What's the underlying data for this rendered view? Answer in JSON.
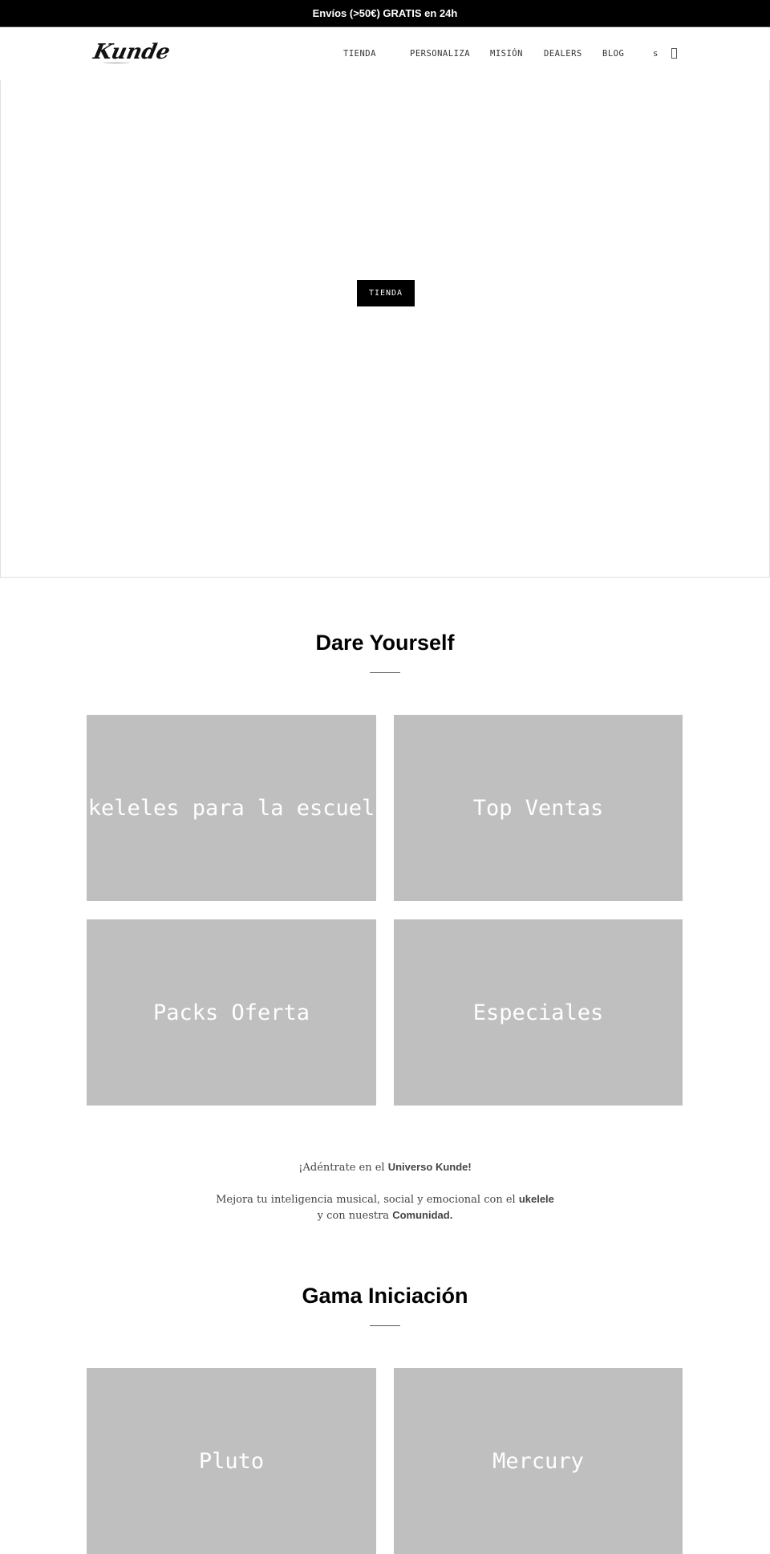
{
  "announcement": {
    "text": "Envíos (>50€) GRATIS en 24h"
  },
  "header": {
    "logo": "Kunde",
    "nav": [
      {
        "label": "TIENDA"
      },
      {
        "label": "PERSONALIZA"
      },
      {
        "label": "MISIÓN"
      },
      {
        "label": "DEALERS"
      },
      {
        "label": "BLOG"
      }
    ],
    "search_label": "s",
    "cart_icon": "cart-icon"
  },
  "hero": {
    "button_label": "TIENDA"
  },
  "dare_section": {
    "title": "Dare Yourself",
    "tiles": [
      {
        "label": "Ukeleles para la escuela"
      },
      {
        "label": "Top Ventas"
      },
      {
        "label": "Packs Oferta"
      },
      {
        "label": "Especiales"
      }
    ],
    "tile_color": "#bfbfbf"
  },
  "intro": {
    "line1_prefix": "¡Adéntrate en el ",
    "line1_bold": "Universo Kunde!",
    "line2_prefix": "Mejora tu inteligencia musical, social y emocional con el ",
    "line2_bold": "ukelele",
    "line3_prefix": "y con nuestra ",
    "line3_bold": "Comunidad."
  },
  "gama_section": {
    "title": "Gama Iniciación",
    "tiles": [
      {
        "label": "Pluto"
      },
      {
        "label": "Mercury"
      }
    ]
  }
}
